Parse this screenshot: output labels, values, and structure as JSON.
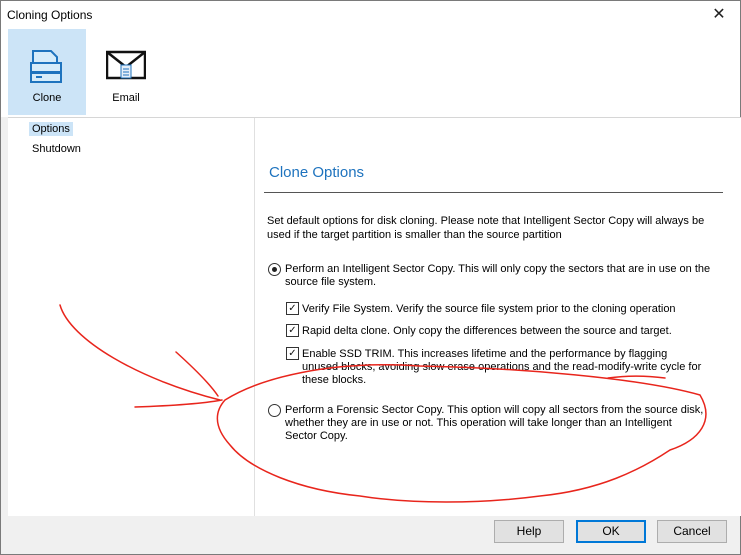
{
  "window": {
    "title": "Cloning Options",
    "close_glyph": "✕"
  },
  "toolbar": {
    "items": [
      {
        "label": "Clone",
        "icon": "clone-disk-icon",
        "selected": true
      },
      {
        "label": "Email",
        "icon": "email-envelope-icon",
        "selected": false
      }
    ]
  },
  "nav": {
    "items": [
      {
        "label": "Options",
        "selected": true
      },
      {
        "label": "Shutdown",
        "selected": false
      }
    ]
  },
  "panel": {
    "title": "Clone Options",
    "description": "Set default options for disk cloning.  Please note that Intelligent Sector Copy will always be used if the target partition is smaller than the source partition",
    "intelligent": {
      "label": "Perform an Intelligent Sector Copy.  This will only copy the sectors that are in use on the source file system.",
      "checked": true
    },
    "checks": [
      {
        "label": "Verify File System.  Verify the source file system prior to the cloning operation",
        "checked": true
      },
      {
        "label": "Rapid delta clone.  Only copy the differences between the source and target.",
        "checked": true
      },
      {
        "label": "Enable SSD TRIM. This increases lifetime and the performance by flagging unused blocks, avoiding slow erase operations and the read-modify-write cycle for these blocks.",
        "checked": true
      }
    ],
    "forensic": {
      "label": "Perform a Forensic Sector Copy. This option will copy all sectors from the source disk, whether they are in use or not.  This operation will take longer than an Intelligent Sector Copy.",
      "checked": false
    }
  },
  "buttons": {
    "help": "Help",
    "ok": "OK",
    "cancel": "Cancel"
  },
  "colors": {
    "accent": "#1e73be",
    "selection": "#cce4f7",
    "annotation": "#e8251c"
  }
}
